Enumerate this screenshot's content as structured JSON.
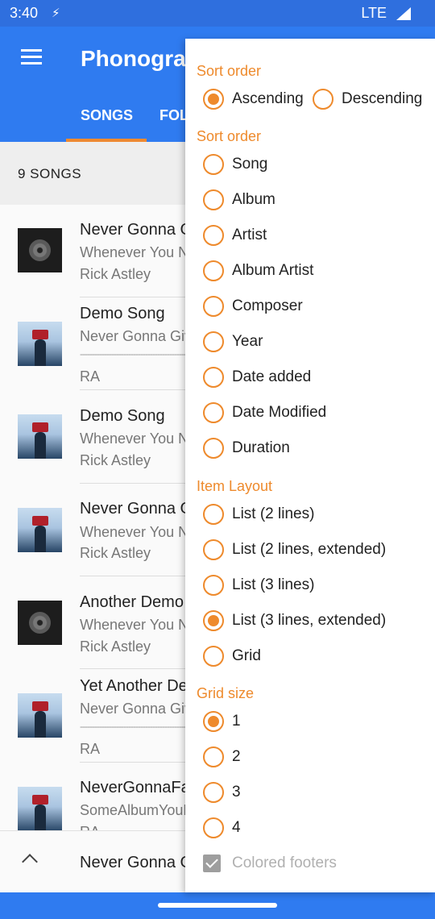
{
  "status_bar": {
    "time": "3:40",
    "network": "LTE"
  },
  "app_bar": {
    "title": "Phonograph",
    "tabs": [
      "SONGS",
      "FOLDERS"
    ]
  },
  "songs_header": {
    "count_label": "9 SONGS"
  },
  "songs": [
    {
      "title": "Never Gonna Give You Up",
      "line2": "Whenever You Need Somebody",
      "line3": "Rick Astley",
      "art": "disc"
    },
    {
      "title": "Demo Song",
      "line2": "Never Gonna Give You Up",
      "dash": "--------------------------------------------",
      "line3": "RA",
      "art": "cover"
    },
    {
      "title": "Demo Song",
      "line2": "Whenever You Need Somebody",
      "line3": "Rick Astley",
      "art": "cover"
    },
    {
      "title": "Never Gonna Give You Up",
      "line2": "Whenever You Need Somebody",
      "line3": "Rick Astley",
      "art": "cover"
    },
    {
      "title": "Another Demo Song",
      "line2": "Whenever You Need Somebody",
      "line3": "Rick Astley",
      "art": "disc"
    },
    {
      "title": "Yet Another Demo Song",
      "line2": "Never Gonna Give You Up",
      "dash": "--------------------------------------------",
      "line3": "RA",
      "art": "cover"
    },
    {
      "title": "NeverGonnaFakeSong",
      "line2": "SomeAlbumYouNeverHeard",
      "line3": "RA",
      "art": "cover"
    }
  ],
  "mini_player": {
    "title": "Never Gonna Give You Up"
  },
  "menu": {
    "sort_direction": {
      "header": "Sort order",
      "options": [
        {
          "label": "Ascending",
          "selected": true
        },
        {
          "label": "Descending",
          "selected": false
        }
      ]
    },
    "sort_order": {
      "header": "Sort order",
      "options": [
        "Song",
        "Album",
        "Artist",
        "Album Artist",
        "Composer",
        "Year",
        "Date added",
        "Date Modified",
        "Duration"
      ],
      "selected": null
    },
    "item_layout": {
      "header": "Item Layout",
      "options": [
        "List (2 lines)",
        "List (2 lines, extended)",
        "List (3 lines)",
        "List (3 lines, extended)",
        "Grid"
      ],
      "selected": "List (3 lines, extended)"
    },
    "grid_size": {
      "header": "Grid size",
      "options": [
        "1",
        "2",
        "3",
        "4"
      ],
      "selected": "1"
    },
    "colored_footers": {
      "label": "Colored footers",
      "checked": true,
      "enabled": false
    }
  },
  "colors": {
    "primary": "#2f7bf0",
    "status_bar": "#2f6fde",
    "accent": "#ee8a2c"
  }
}
